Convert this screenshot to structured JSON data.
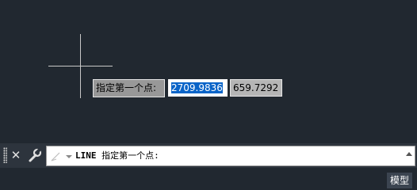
{
  "canvas": {
    "dynamic_input": {
      "prompt": "指定第一个点:",
      "x_value": "2709.9836",
      "y_value": "659.7292"
    }
  },
  "command_line": {
    "command": "LINE",
    "prompt": "指定第一个点:"
  },
  "status_bar": {
    "model_tab": "模型"
  },
  "icons": [
    "crosshair-cursor",
    "close-icon",
    "wrench-icon",
    "command-icon",
    "chevron-up-icon"
  ]
}
